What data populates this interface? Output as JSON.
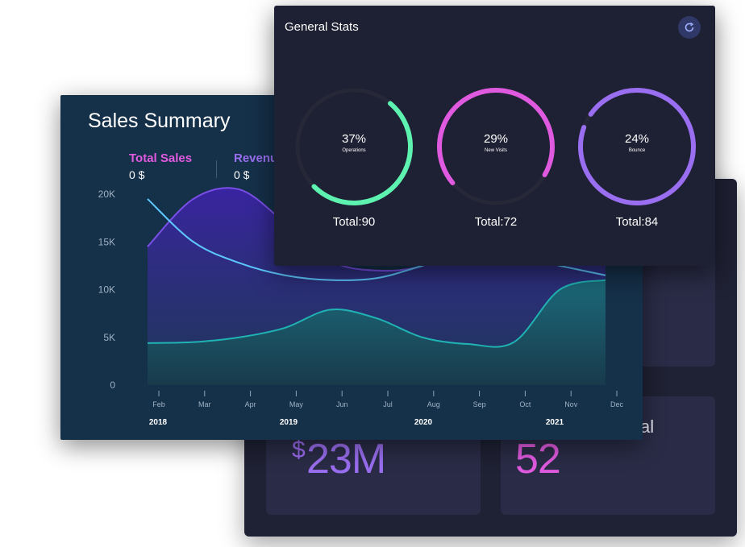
{
  "general_stats": {
    "title": "General Stats",
    "refresh_icon": "refresh-icon",
    "gauges": [
      {
        "percent_label": "37%",
        "label": "Operations",
        "total": "Total:90",
        "value": 0.37,
        "color": "#5ef2b0"
      },
      {
        "percent_label": "29%",
        "label": "New Visits",
        "total": "Total:72",
        "value": 0.29,
        "color": "#e05ae0"
      },
      {
        "percent_label": "24%",
        "label": "Bounce",
        "total": "Total:84",
        "value": 0.24,
        "color": "#9a6ef0"
      }
    ]
  },
  "sales_summary": {
    "title": "Sales Summary",
    "kpis": [
      {
        "label": "Total Sales",
        "value": "0 $",
        "color": "#e05ae0"
      },
      {
        "label": "Revenu",
        "value": "0 $",
        "color": "#9a6ef0"
      }
    ]
  },
  "tiles": {
    "bottom_left_value": "23M",
    "bottom_left_currency": "$",
    "bottom_right_title": "val",
    "bottom_right_value": "52",
    "bottom_left_color": "#9a6ef0",
    "bottom_right_color": "#e05ae0"
  },
  "chart_data": {
    "type": "area",
    "y_ticks": [
      "20K",
      "15K",
      "10K",
      "5K",
      "0"
    ],
    "ylim": [
      0,
      20000
    ],
    "x_months": [
      "Feb",
      "Mar",
      "Apr",
      "May",
      "Jun",
      "Jul",
      "Aug",
      "Sep",
      "Oct",
      "Nov",
      "Dec"
    ],
    "x_years": [
      "2018",
      "2019",
      "2020",
      "2021"
    ],
    "series": [
      {
        "values": [
          14500,
          19500,
          20500,
          17000,
          13000,
          12000,
          12500,
          15000,
          17000,
          16000,
          13500
        ],
        "color": "#7a4fe8"
      },
      {
        "values": [
          19500,
          15000,
          12800,
          11500,
          11000,
          11200,
          12500,
          14000,
          13500,
          12500,
          11500
        ],
        "color": "#5cc8ff"
      },
      {
        "values": [
          4400,
          4500,
          5000,
          6000,
          7900,
          7000,
          5000,
          4300,
          4500,
          10000,
          11000
        ],
        "color": "#1fb3b3"
      }
    ]
  }
}
